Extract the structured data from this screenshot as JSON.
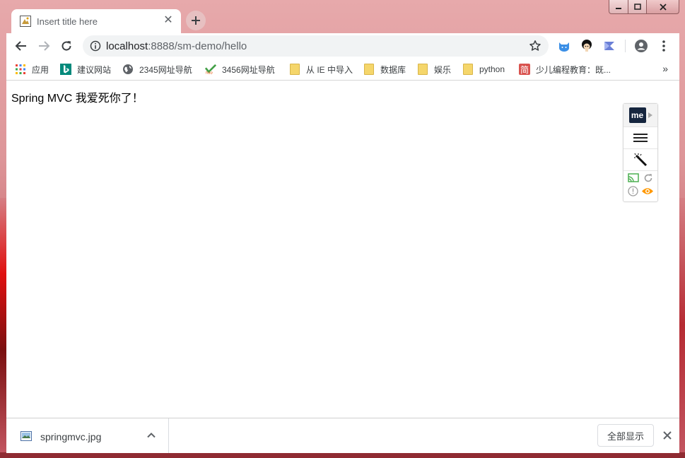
{
  "browser": {
    "tab": {
      "title": "Insert title here",
      "close_symbol": "✕"
    },
    "new_tab_symbol": "+",
    "address": {
      "host": "localhost",
      "port_path": ":8888/sm-demo/hello"
    },
    "bookmarks": [
      {
        "label": "应用",
        "icon": "apps-grid-icon"
      },
      {
        "label": "建议网站",
        "icon": "bing-icon"
      },
      {
        "label": "2345网址导航",
        "icon": "globe-icon"
      },
      {
        "label": "3456网址导航",
        "icon": "hao-icon"
      },
      {
        "label": "从 IE 中导入",
        "icon": "folder-icon"
      },
      {
        "label": "数据库",
        "icon": "folder-icon"
      },
      {
        "label": "娱乐",
        "icon": "folder-icon"
      },
      {
        "label": "python",
        "icon": "folder-icon"
      },
      {
        "label": "少儿编程教育：既...",
        "icon": "jian-icon"
      }
    ],
    "bookmarks_more": "»"
  },
  "page": {
    "message": "Spring MVC 我爱死你了！"
  },
  "extension_panel": {
    "badge_text": "me"
  },
  "downloads": {
    "file_name": "springmvc.jpg",
    "show_all_label": "全部显示"
  },
  "colors": {
    "frame": "#dd9598",
    "toolbar": "#ffffff",
    "accent_blue": "#1a73e8",
    "folder_yellow": "#f5d66b"
  }
}
